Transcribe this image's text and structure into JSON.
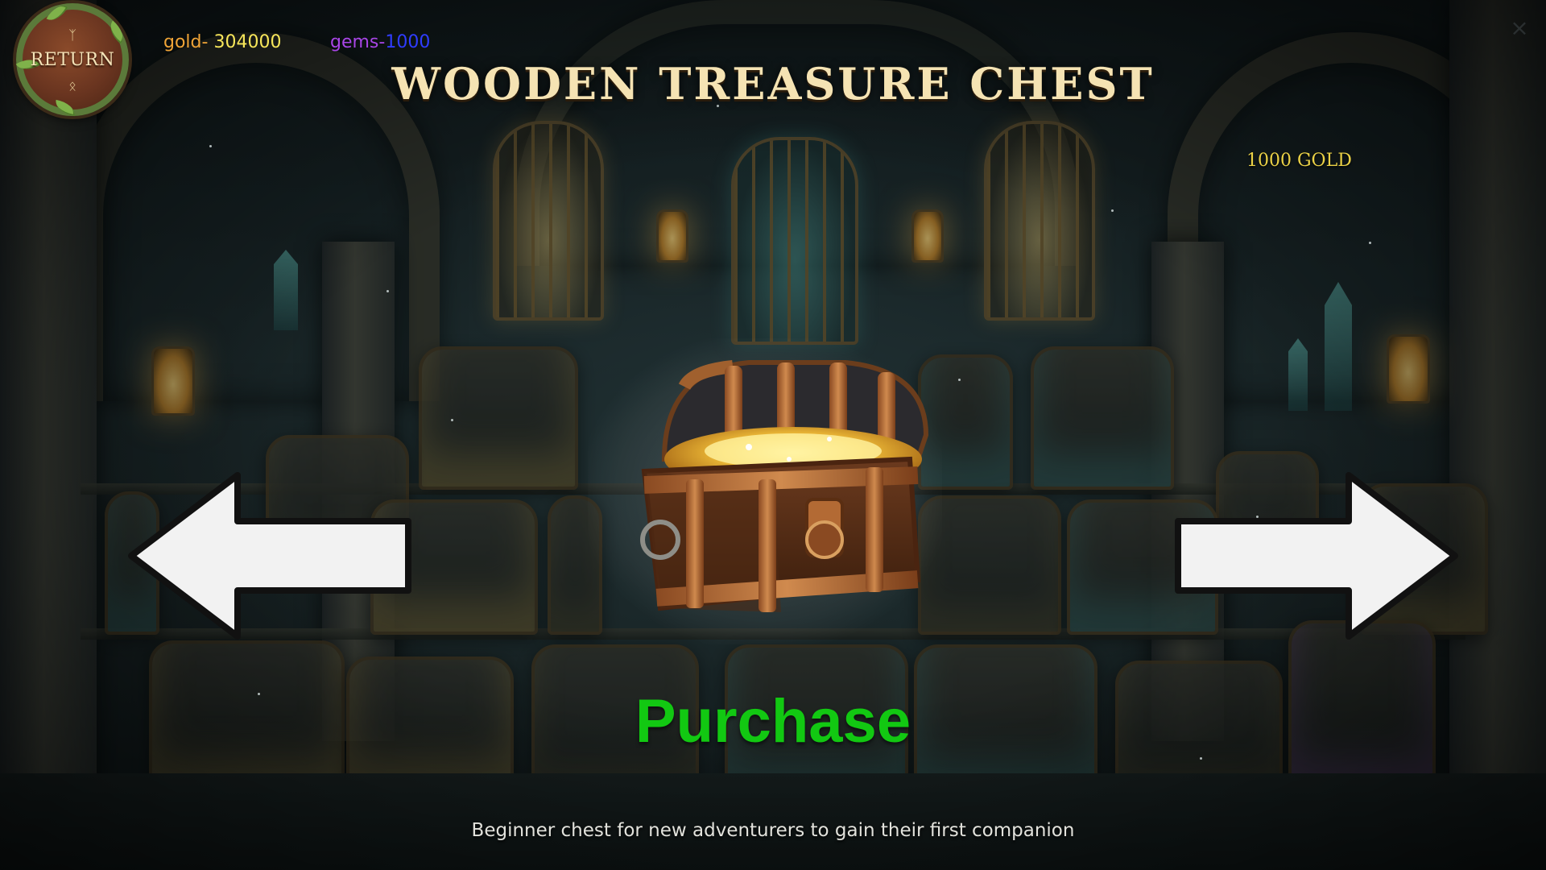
{
  "hud": {
    "return_label": "RETURN",
    "gold_label": "gold-",
    "gold_value": "304000",
    "gems_label": "gems-",
    "gems_value": "1000",
    "close_symbol": "×"
  },
  "item": {
    "title": "WOODEN TREASURE CHEST",
    "price": "1000 GOLD",
    "description": "Beginner chest for new adventurers to gain their first companion",
    "icon": "wooden-treasure-chest-icon"
  },
  "actions": {
    "purchase_label": "Purchase",
    "prev_icon": "left-arrow-icon",
    "next_icon": "right-arrow-icon"
  },
  "colors": {
    "gold_label": "#f0a437",
    "gold_value": "#f7e65a",
    "gems_label": "#a845e6",
    "gems_value": "#2f3cff",
    "title": "#f5e3b3",
    "price": "#ecd246",
    "purchase": "#12c812"
  }
}
